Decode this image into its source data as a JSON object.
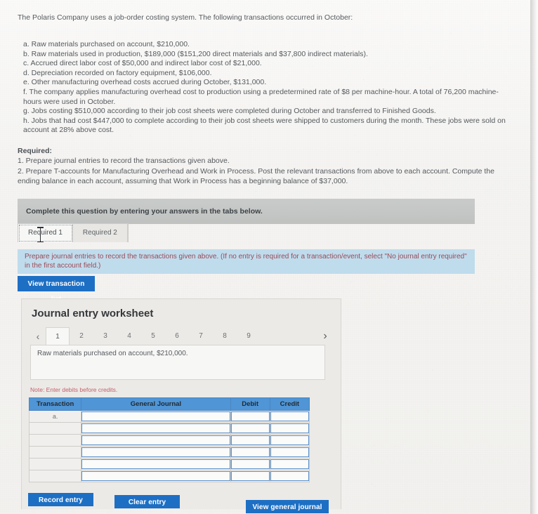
{
  "problem": {
    "intro": "The Polaris Company uses a job-order costing system. The following transactions occurred in October:",
    "items": [
      "a. Raw materials purchased on account, $210,000.",
      "b. Raw materials used in production, $189,000 ($151,200 direct materials and $37,800 indirect materials).",
      "c. Accrued direct labor cost of $50,000 and indirect labor cost of $21,000.",
      "d. Depreciation recorded on factory equipment, $106,000.",
      "e. Other manufacturing overhead costs accrued during October, $131,000.",
      "f. The company applies manufacturing overhead cost to production using a predetermined rate of $8 per machine-hour. A total of 76,200 machine-hours were used in October.",
      "g. Jobs costing $510,000 according to their job cost sheets were completed during October and transferred to Finished Goods.",
      "h. Jobs that had cost $447,000 to complete according to their job cost sheets were shipped to customers during the month. These jobs were sold on account at 28% above cost."
    ],
    "required_heading": "Required:",
    "required_lines": [
      "1. Prepare journal entries to record the transactions given above.",
      "2. Prepare T-accounts for Manufacturing Overhead and Work in Process. Post the relevant transactions from above to each account. Compute the ending balance in each account, assuming that Work in Process has a beginning balance of $37,000."
    ]
  },
  "banner": {
    "gray_text": "Complete this question by entering your answers in the tabs below."
  },
  "tabs": [
    {
      "label": "Required 1",
      "active": true
    },
    {
      "label": "Required 2",
      "active": false
    }
  ],
  "instruction": {
    "text": "Prepare journal entries to record the transactions given above. (If no entry is required for a transaction/event, select \"No journal entry required\" in the first account field.)"
  },
  "buttons": {
    "view_transaction_list": "View transaction list",
    "record_entry": "Record entry",
    "clear_entry": "Clear entry",
    "view_general_journal": "View general journal"
  },
  "worksheet": {
    "title": "Journal entry worksheet",
    "prev_icon": "chevron-left-icon",
    "next_icon": "chevron-right-icon",
    "pages": [
      "1",
      "2",
      "3",
      "4",
      "5",
      "6",
      "7",
      "8",
      "9"
    ],
    "active_page": "1",
    "transaction_text": "Raw materials purchased on account, $210,000.",
    "note": "Note: Enter debits before credits.",
    "table": {
      "headers": [
        "Transaction",
        "General Journal",
        "Debit",
        "Credit"
      ],
      "rows": [
        {
          "transaction": "a.",
          "general_journal": "",
          "debit": "",
          "credit": ""
        },
        {
          "transaction": "",
          "general_journal": "",
          "debit": "",
          "credit": ""
        },
        {
          "transaction": "",
          "general_journal": "",
          "debit": "",
          "credit": ""
        },
        {
          "transaction": "",
          "general_journal": "",
          "debit": "",
          "credit": ""
        },
        {
          "transaction": "",
          "general_journal": "",
          "debit": "",
          "credit": ""
        },
        {
          "transaction": "",
          "general_journal": "",
          "debit": "",
          "credit": ""
        }
      ]
    }
  },
  "colors": {
    "primary_button": "#1d6fc4",
    "table_header": "#5095d5",
    "instruction_banner": "#bfdced",
    "gray_banner": "#c4c6c5",
    "note_text": "#c4606a"
  }
}
